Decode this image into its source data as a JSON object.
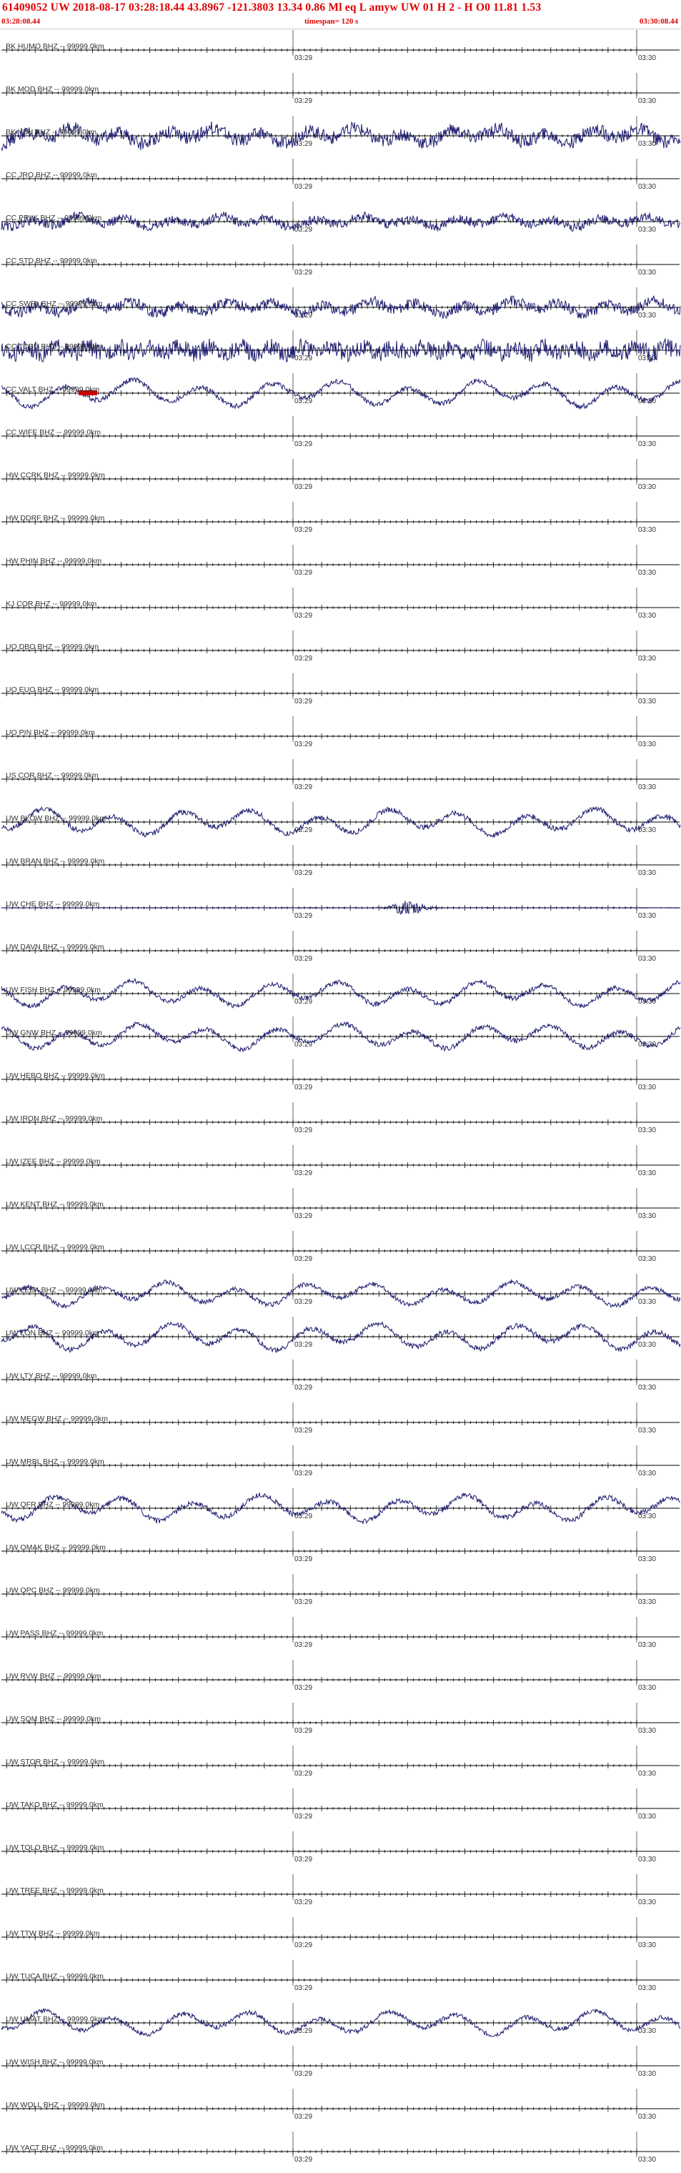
{
  "header": {
    "main": "61409052 UW 2018-08-17 03:28:18.44    43.8967 -121.3803  13.34  0.86 Ml  eq  L amyw     UW 01  H   2   -   H O0    11.81  1.53",
    "start_time": "03:28:08.44",
    "timespan": "timespan= 120 s",
    "end_time": "03:30:08.44"
  },
  "colors": {
    "trace": "#1c1c6e",
    "header_text": "#e00000",
    "axis": "#000000",
    "pick": "#cc0000"
  },
  "chart_data": {
    "type": "line",
    "title": "61409052 UW 2018-08-17 03:28:18.44    43.8967 -121.3803  13.34  0.86 Ml  eq  L amyw     UW 01  H   2   -   H O0    11.81  1.53",
    "xlabel": "",
    "ylabel": "",
    "x_range": [
      "03:28:08.44",
      "03:30:08.44"
    ],
    "timespan_s": 120,
    "time_tick_labels": [
      "03:29",
      "03:30"
    ],
    "grid": false,
    "channels": [
      {
        "label": "BK HUMO BHZ -- 99999.0km",
        "amplitude": 0,
        "character": "flat"
      },
      {
        "label": "BK MOD BHZ -- 99999.0km",
        "amplitude": 0,
        "character": "flat"
      },
      {
        "label": "BK YBH BHZ -- 99999.0km",
        "amplitude": 0.85,
        "character": "noisy"
      },
      {
        "label": "CC JRO BHZ -- 99999.0km",
        "amplitude": 0,
        "character": "flat"
      },
      {
        "label": "CC PRLK BHZ -- 99999.0km",
        "amplitude": 0.6,
        "character": "noisy"
      },
      {
        "label": "CC STD BHZ -- 99999.0km",
        "amplitude": 0,
        "character": "flat"
      },
      {
        "label": "CC SWFL BHZ -- 99999.0km",
        "amplitude": 0.7,
        "character": "noisy"
      },
      {
        "label": "CC TCBU BHZ -- 99999.0km",
        "amplitude": 0.7,
        "character": "dense"
      },
      {
        "label": "CC VALT BHZ -- 99999.0km",
        "amplitude": 0.95,
        "character": "wave",
        "pick_marker": true
      },
      {
        "label": "CC WIFE BHZ -- 99999.0km",
        "amplitude": 0,
        "character": "flat"
      },
      {
        "label": "HW CCRK BHZ -- 99999.0km",
        "amplitude": 0,
        "character": "flat"
      },
      {
        "label": "HW DDRF BHZ -- 99999.0km",
        "amplitude": 0,
        "character": "flat"
      },
      {
        "label": "HW PHIN BHZ -- 99999.0km",
        "amplitude": 0,
        "character": "flat"
      },
      {
        "label": "KJ COR BHZ -- 99999.0km",
        "amplitude": 0,
        "character": "flat"
      },
      {
        "label": "UO DBO BHZ -- 99999.0km",
        "amplitude": 0,
        "character": "flat"
      },
      {
        "label": "UO EUO BHZ -- 99999.0km",
        "amplitude": 0,
        "character": "flat"
      },
      {
        "label": "UO PIN BHZ -- 99999.0km",
        "amplitude": 0,
        "character": "flat"
      },
      {
        "label": "US COR BHZ -- 99999.0km",
        "amplitude": 0,
        "character": "flat"
      },
      {
        "label": "UW BLOW BHZ -- 99999.0km",
        "amplitude": 0.95,
        "character": "wave"
      },
      {
        "label": "UW BRAN BHZ -- 99999.0km",
        "amplitude": 0,
        "character": "flat"
      },
      {
        "label": "UW CHE BHZ -- 99999.0km",
        "amplitude": 0.08,
        "character": "event",
        "event_at_fraction": 0.6
      },
      {
        "label": "UW DAVN BHZ -- 99999.0km",
        "amplitude": 0,
        "character": "flat"
      },
      {
        "label": "UW FISH BHZ -- 99999.0km",
        "amplitude": 0.9,
        "character": "wave"
      },
      {
        "label": "UW GNW BHZ -- 99999.0km",
        "amplitude": 0.9,
        "character": "wave"
      },
      {
        "label": "UW HEBO BHZ -- 99999.0km",
        "amplitude": 0,
        "character": "flat"
      },
      {
        "label": "UW IRON BHZ -- 99999.0km",
        "amplitude": 0,
        "character": "flat"
      },
      {
        "label": "UW IZEE BHZ -- 99999.0km",
        "amplitude": 0,
        "character": "flat"
      },
      {
        "label": "UW KENT BHZ -- 99999.0km",
        "amplitude": 0,
        "character": "flat"
      },
      {
        "label": "UW LCCR BHZ -- 99999.0km",
        "amplitude": 0,
        "character": "flat"
      },
      {
        "label": "UW LEBA BHZ -- 99999.0km",
        "amplitude": 0.85,
        "character": "wave"
      },
      {
        "label": "UW LON BHZ -- 99999.0km",
        "amplitude": 0.95,
        "character": "wave"
      },
      {
        "label": "UW LTY BHZ -- 99999.0km",
        "amplitude": 0,
        "character": "flat"
      },
      {
        "label": "UW MEGW BHZ -- 99999.0km",
        "amplitude": 0,
        "character": "flat"
      },
      {
        "label": "UW MRBL BHZ -- 99999.0km",
        "amplitude": 0,
        "character": "flat"
      },
      {
        "label": "UW OFR BHZ -- 99999.0km",
        "amplitude": 0.95,
        "character": "wave"
      },
      {
        "label": "UW OMAK BHZ -- 99999.0km",
        "amplitude": 0,
        "character": "flat"
      },
      {
        "label": "UW OPC BHZ -- 99999.0km",
        "amplitude": 0,
        "character": "flat"
      },
      {
        "label": "UW PASS BHZ -- 99999.0km",
        "amplitude": 0,
        "character": "flat"
      },
      {
        "label": "UW RVW BHZ -- 99999.0km",
        "amplitude": 0,
        "character": "flat"
      },
      {
        "label": "UW SQM BHZ -- 99999.0km",
        "amplitude": 0,
        "character": "flat"
      },
      {
        "label": "UW STOR BHZ -- 99999.0km",
        "amplitude": 0,
        "character": "flat"
      },
      {
        "label": "UW TAKO BHZ -- 99999.0km",
        "amplitude": 0,
        "character": "flat"
      },
      {
        "label": "UW TOLO BHZ -- 99999.0km",
        "amplitude": 0,
        "character": "flat"
      },
      {
        "label": "UW TREE BHZ -- 99999.0km",
        "amplitude": 0,
        "character": "flat"
      },
      {
        "label": "UW TTW BHZ -- 99999.0km",
        "amplitude": 0,
        "character": "flat"
      },
      {
        "label": "UW TUCA BHZ -- 99999.0km",
        "amplitude": 0,
        "character": "flat"
      },
      {
        "label": "UW UMAT BHZ -- 99999.0km",
        "amplitude": 0.85,
        "character": "wave"
      },
      {
        "label": "UW WISH BHZ -- 99999.0km",
        "amplitude": 0,
        "character": "flat"
      },
      {
        "label": "UW WOLL BHZ -- 99999.0km",
        "amplitude": 0,
        "character": "flat"
      },
      {
        "label": "UW YACT BHZ -- 99999.0km",
        "amplitude": 0,
        "character": "flat"
      }
    ]
  }
}
